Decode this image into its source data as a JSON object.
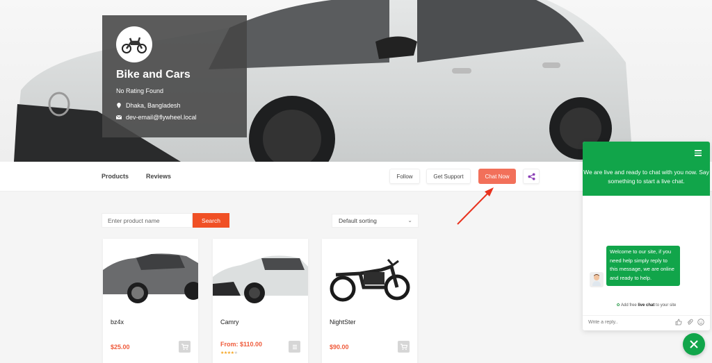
{
  "store": {
    "name": "Bike and Cars",
    "rating_text": "No Rating Found",
    "location": "Dhaka, Bangladesh",
    "email": "dev-email@flywheel.local"
  },
  "tabs": [
    {
      "label": "Products"
    },
    {
      "label": "Reviews"
    }
  ],
  "actions": {
    "follow": "Follow",
    "get_support": "Get Support",
    "chat_now": "Chat Now"
  },
  "search": {
    "placeholder": "Enter product name",
    "button": "Search"
  },
  "sorting": {
    "selected": "Default sorting"
  },
  "products": [
    {
      "name": "bz4x",
      "price": "$25.00",
      "action": "add-to-cart"
    },
    {
      "name": "Camry",
      "price": "From: $110.00",
      "rating": 4,
      "rating_max": 5,
      "action": "select-options"
    },
    {
      "name": "NightSter",
      "price": "$90.00",
      "action": "add-to-cart"
    }
  ],
  "chat": {
    "header_text": "We are live and ready to chat with you now. Say something to start a live chat.",
    "welcome_message": "Welcome to our site, if you need help simply reply to this message, we are online and ready to help.",
    "powered_prefix": "Add free ",
    "powered_bold": "live chat",
    "powered_suffix": " to your site",
    "reply_placeholder": "Write a reply.."
  },
  "colors": {
    "accent_orange": "#f05025",
    "chat_button": "#f2705a",
    "chat_green": "#11a54a",
    "price": "#ef5a3a",
    "share_purple": "#8a3fb5"
  }
}
